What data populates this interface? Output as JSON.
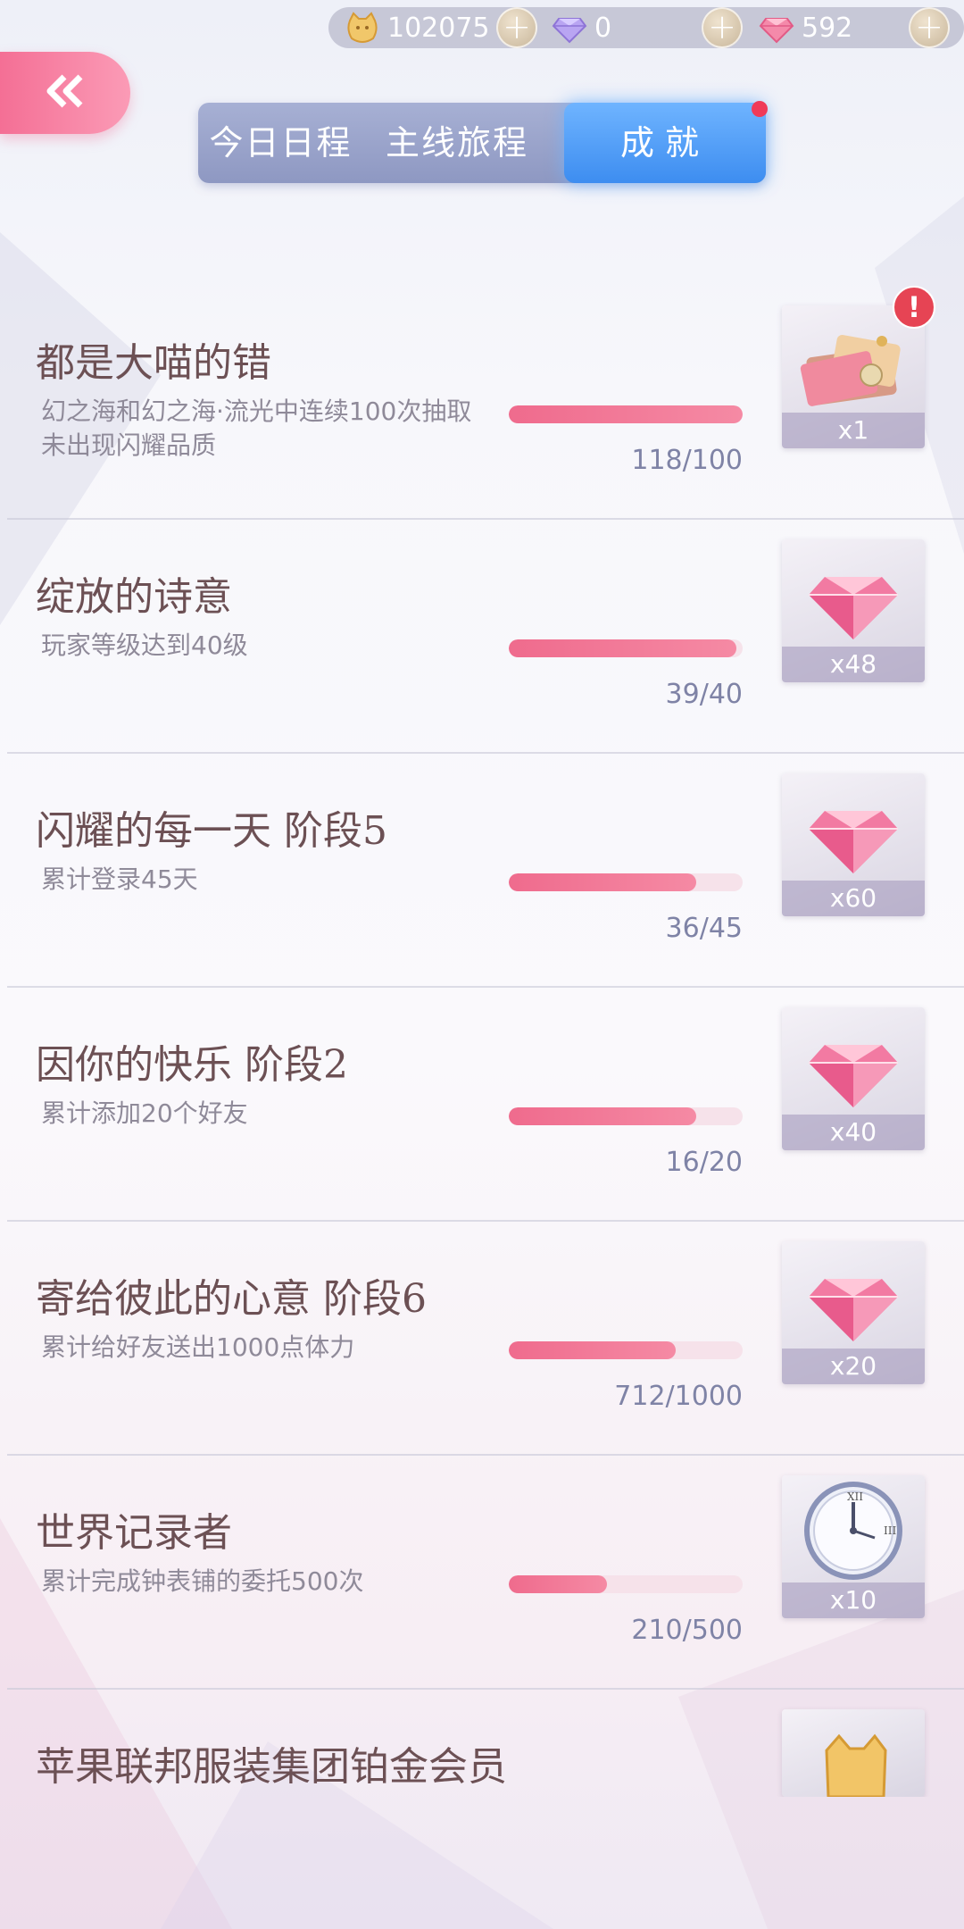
{
  "currencies": {
    "coins": {
      "icon": "cat-coin-icon",
      "value": "102075"
    },
    "purple_gems": {
      "icon": "purple-diamond-icon",
      "value": "0"
    },
    "pink_gems": {
      "icon": "pink-diamond-icon",
      "value": "592"
    }
  },
  "tabs": [
    {
      "label": "今日日程",
      "active": false
    },
    {
      "label": "主线旅程",
      "active": false
    },
    {
      "label": "成就",
      "active": true
    }
  ],
  "achievements": [
    {
      "title": "都是大喵的错",
      "desc": "幻之海和幻之海·流光中连续100次抽取未出现闪耀品质",
      "progress_text": "118/100",
      "progress_fraction": 1.0,
      "reward_icon": "ticket-box-icon",
      "reward_qty": "x1",
      "alert": true,
      "alert_text": "!"
    },
    {
      "title": "绽放的诗意",
      "desc": "玩家等级达到40级",
      "progress_text": "39/40",
      "progress_fraction": 0.975,
      "reward_icon": "pink-diamond-icon",
      "reward_qty": "x48"
    },
    {
      "title": "闪耀的每一天 阶段5",
      "desc": "累计登录45天",
      "progress_text": "36/45",
      "progress_fraction": 0.8,
      "reward_icon": "pink-diamond-icon",
      "reward_qty": "x60"
    },
    {
      "title": "因你的快乐 阶段2",
      "desc": "累计添加20个好友",
      "progress_text": "16/20",
      "progress_fraction": 0.8,
      "reward_icon": "pink-diamond-icon",
      "reward_qty": "x40"
    },
    {
      "title": "寄给彼此的心意  阶段6",
      "desc": "累计给好友送出1000点体力",
      "progress_text": "712/1000",
      "progress_fraction": 0.712,
      "reward_icon": "pink-diamond-icon",
      "reward_qty": "x20"
    },
    {
      "title": "世界记录者",
      "desc": "累计完成钟表铺的委托500次",
      "progress_text": "210/500",
      "progress_fraction": 0.42,
      "reward_icon": "clock-icon",
      "reward_qty": "x10"
    },
    {
      "title": "苹果联邦服装集团铂金会员",
      "reward_icon": "cat-coin-icon"
    }
  ]
}
